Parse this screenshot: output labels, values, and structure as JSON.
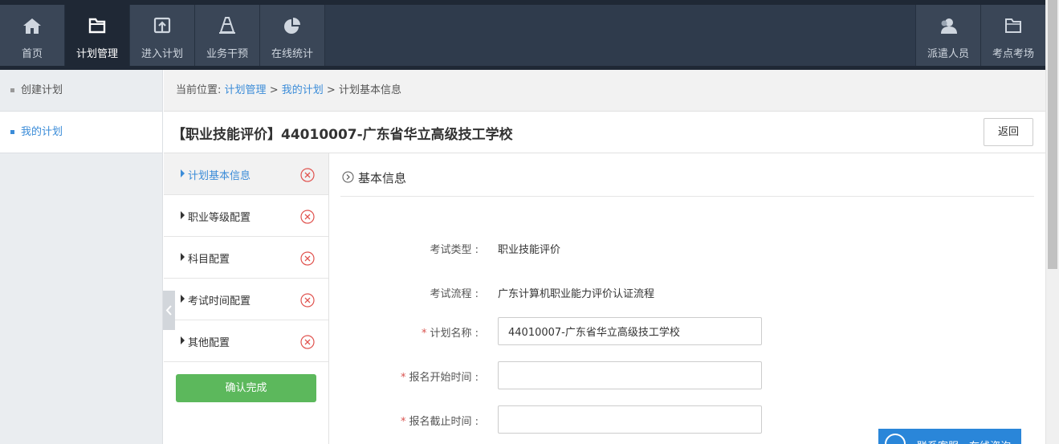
{
  "nav": {
    "left": [
      {
        "label": "首页",
        "icon": "home-icon"
      },
      {
        "label": "计划管理",
        "icon": "folder-icon",
        "active": true
      },
      {
        "label": "进入计划",
        "icon": "enter-icon"
      },
      {
        "label": "业务干预",
        "icon": "cone-icon"
      },
      {
        "label": "在线统计",
        "icon": "pie-chart-icon"
      }
    ],
    "right": [
      {
        "label": "派遣人员",
        "icon": "user-icon"
      },
      {
        "label": "考点考场",
        "icon": "folder-icon"
      }
    ]
  },
  "sidebar": {
    "items": [
      {
        "label": "创建计划"
      },
      {
        "label": "我的计划",
        "active": true
      }
    ]
  },
  "breadcrumb": {
    "prefix": "当前位置:",
    "links": [
      "计划管理",
      "我的计划"
    ],
    "separator": ">",
    "current": "计划基本信息"
  },
  "page": {
    "title": "【职业技能评价】44010007-广东省华立高级技工学校",
    "back_label": "返回"
  },
  "steps": {
    "items": [
      {
        "label": "计划基本信息",
        "active": true
      },
      {
        "label": "职业等级配置"
      },
      {
        "label": "科目配置"
      },
      {
        "label": "考试时间配置"
      },
      {
        "label": "其他配置"
      }
    ],
    "confirm_label": "确认完成"
  },
  "form": {
    "section_title": "基本信息",
    "exam_type": {
      "label": "考试类型",
      "colon": ":",
      "value": "职业技能评价"
    },
    "exam_flow": {
      "label": "考试流程",
      "colon": ":",
      "value": "广东计算机职业能力评价认证流程"
    },
    "plan_name": {
      "required": "*",
      "label": "计划名称",
      "colon": ":",
      "value": "44010007-广东省华立高级技工学校"
    },
    "reg_start": {
      "required": "*",
      "label": "报名开始时间",
      "colon": ":",
      "value": ""
    },
    "reg_end": {
      "required": "*",
      "label": "报名截止时间",
      "colon": ":",
      "value": ""
    }
  },
  "consult": {
    "label": "联系客服，在线咨询"
  },
  "colors": {
    "nav_bg": "#3a4657",
    "nav_active": "#1f2835",
    "link": "#3b8cd8",
    "confirm": "#5cb85c",
    "required": "#d9534f",
    "consult_bg": "#2a86d9"
  }
}
